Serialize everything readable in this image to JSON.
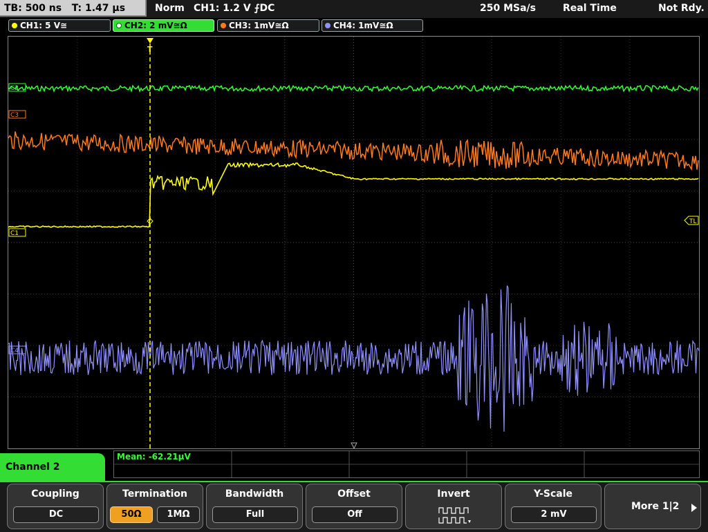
{
  "status": {
    "timebase": "TB: 500 ns",
    "trigger_pos": "T: 1.47 µs",
    "mode": "Norm",
    "trigger_source": "CH1: 1.2 V ⨍DC",
    "sample_rate": "250 MSa/s",
    "acq_mode": "Real Time",
    "state": "Not Rdy."
  },
  "channels": [
    {
      "label": "CH1: 5 V≅",
      "color": "#ffff00"
    },
    {
      "label": "CH2: 2 mV≅Ω",
      "color": "#33ff33"
    },
    {
      "label": "CH3: 1mV≅Ω",
      "color": "#ff7a1a"
    },
    {
      "label": "CH4: 1mV≅Ω",
      "color": "#9090ff"
    }
  ],
  "markers": {
    "ch2": "C2",
    "ch3": "C3",
    "ch1": "C1",
    "ch4": "C4",
    "trigger_level": "TL",
    "trigger": "T"
  },
  "measurement": {
    "mean": "Mean: -62.21µV"
  },
  "menu": {
    "channel": "Channel 2",
    "coupling": {
      "title": "Coupling",
      "value": "DC"
    },
    "termination": {
      "title": "Termination",
      "opt1": "50Ω",
      "opt2": "1MΩ"
    },
    "bandwidth": {
      "title": "Bandwidth",
      "value": "Full"
    },
    "offset": {
      "title": "Offset",
      "value": "Off"
    },
    "invert": {
      "title": "Invert"
    },
    "yscale": {
      "title": "Y-Scale",
      "value": "2 mV"
    },
    "more": {
      "label": "More 1|2"
    }
  }
}
